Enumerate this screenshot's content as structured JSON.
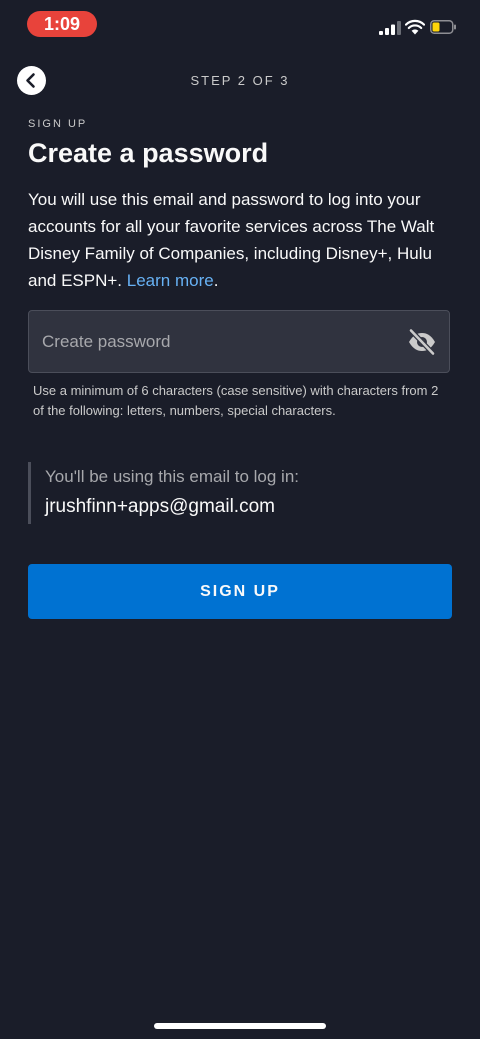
{
  "status_bar": {
    "time": "1:09",
    "signal_icon": "cellular-signal-icon",
    "wifi_icon": "wifi-icon",
    "battery_icon": "battery-low-icon",
    "time_pill_color": "#e8433b",
    "battery_level_color": "#ffd60a"
  },
  "header": {
    "back_icon": "chevron-left-icon",
    "step_label": "STEP 2 OF 3"
  },
  "main": {
    "eyebrow": "SIGN UP",
    "title": "Create a password",
    "description": "You will use this email and password to log into your accounts for all your favorite services across The Walt Disney Family of Companies, including Disney+, Hulu and ESPN+.",
    "learn_more": "Learn more",
    "learn_more_suffix": ".",
    "password_field": {
      "value": "",
      "placeholder": "Create password",
      "toggle_icon": "eye-slash-icon"
    },
    "hint": "Use a minimum of 6 characters (case sensitive) with characters from 2 of the following: letters, numbers, special characters.",
    "email_label": "You'll be using this email to log in:",
    "email_value": "jrushfinn+apps@gmail.com",
    "signup_button": "SIGN UP"
  },
  "colors": {
    "background": "#1a1d29",
    "accent": "#0072d2",
    "link": "#67b1f4",
    "field_background": "#30333f"
  }
}
